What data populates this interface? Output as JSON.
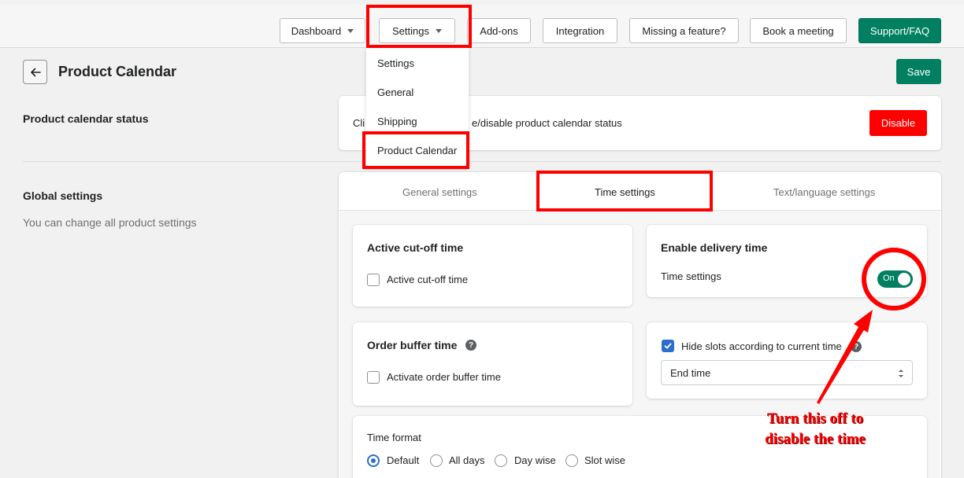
{
  "topnav": {
    "dashboard": "Dashboard",
    "settings": "Settings",
    "addons": "Add-ons",
    "integration": "Integration",
    "missing_feature": "Missing a feature?",
    "book_meeting": "Book a meeting",
    "support": "Support/FAQ"
  },
  "settings_menu": [
    "Settings",
    "General",
    "Shipping",
    "Product Calendar"
  ],
  "page": {
    "title": "Product Calendar",
    "save_label": "Save"
  },
  "status_section": {
    "title": "Product calendar status",
    "desc_prefix": "Cli",
    "desc_suffix": "e/disable product calendar status",
    "disable_label": "Disable"
  },
  "global_section": {
    "title": "Global settings",
    "subtitle": "You can change all product settings"
  },
  "tabs": [
    "General settings",
    "Time settings",
    "Text/language settings"
  ],
  "cutoff": {
    "title": "Active cut-off time",
    "checkbox_label": "Active cut-off time"
  },
  "delivery": {
    "title": "Enable delivery time",
    "label": "Time settings",
    "toggle_text": "On"
  },
  "buffer": {
    "title": "Order buffer time",
    "checkbox_label": "Activate order buffer time"
  },
  "slots": {
    "checkbox_label": "Hide slots according to current time",
    "select_value": "End time"
  },
  "time_format": {
    "label": "Time format",
    "options": [
      "Default",
      "All days",
      "Day wise",
      "Slot wise"
    ]
  },
  "annotation": {
    "line1": "Turn this off to",
    "line2": "disable the time"
  },
  "colors": {
    "primary_green": "#008060",
    "danger_red": "#ff0000",
    "highlight_red": "#ff0000",
    "checkbox_blue": "#2c6ecb"
  }
}
